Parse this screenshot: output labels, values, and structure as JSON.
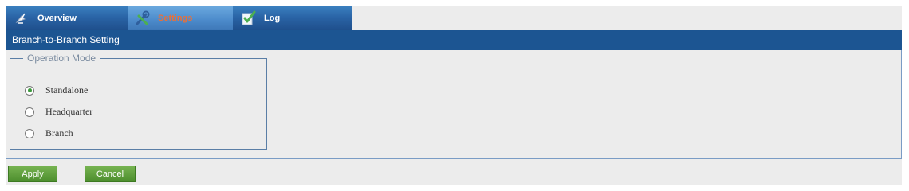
{
  "tabs": [
    {
      "label": "Overview",
      "icon": "satellite-dish-icon"
    },
    {
      "label": "Settings",
      "icon": "tools-icon"
    },
    {
      "label": "Log",
      "icon": "checklist-icon"
    }
  ],
  "active_tab": "Settings",
  "section_title": "Branch-to-Branch Setting",
  "operation_mode": {
    "legend": "Operation Mode",
    "options": [
      "Standalone",
      "Headquarter",
      "Branch"
    ],
    "selected": "Standalone"
  },
  "buttons": {
    "apply": "Apply",
    "cancel": "Cancel"
  },
  "colors": {
    "tab_bar": "#2a64a6",
    "section_bar": "#1c5592",
    "active_tab_text": "#e8703a",
    "button_green": "#5a9d3a"
  }
}
